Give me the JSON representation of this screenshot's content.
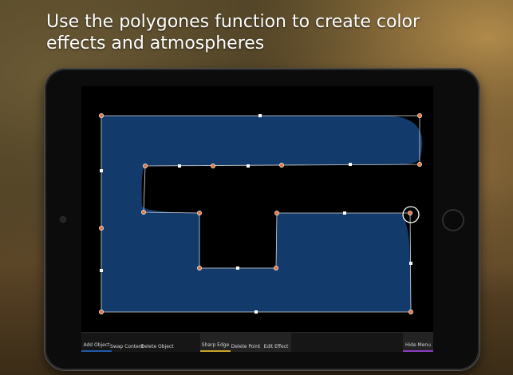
{
  "headline": "Use the polygones function to create color effects and atmospheres",
  "colors": {
    "shape_fill": "#123a6b",
    "handle_orange": "#e8723a",
    "handle_white": "#ffffff",
    "outline": "#d9d9d9"
  },
  "toolbar": {
    "add_object": "Add Object",
    "swap_content": "Swap Content",
    "delete_object": "Delete Object",
    "sharp_edge": "Sharp Edge",
    "delete_point": "Delete Point",
    "edit_effect": "Edit Effect",
    "hide_menu": "Hide Menu"
  }
}
